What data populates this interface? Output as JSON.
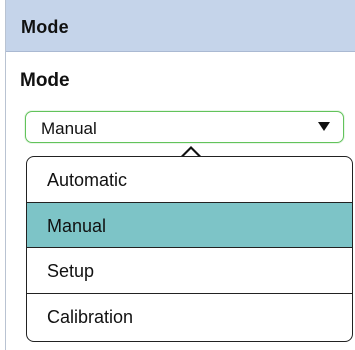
{
  "panel": {
    "header_title": "Mode"
  },
  "field": {
    "label": "Mode",
    "selected_value": "Manual",
    "expanded": true,
    "accent_color": "#62c35b"
  },
  "dropdown": {
    "options": [
      {
        "label": "Automatic",
        "selected": false
      },
      {
        "label": "Manual",
        "selected": true
      },
      {
        "label": "Setup",
        "selected": false
      },
      {
        "label": "Calibration",
        "selected": false
      }
    ],
    "highlight_color": "#7dc4c7"
  },
  "icons": {
    "select_toggle": "chevron-down-icon",
    "popup_pointer": "dropdown-caret"
  }
}
